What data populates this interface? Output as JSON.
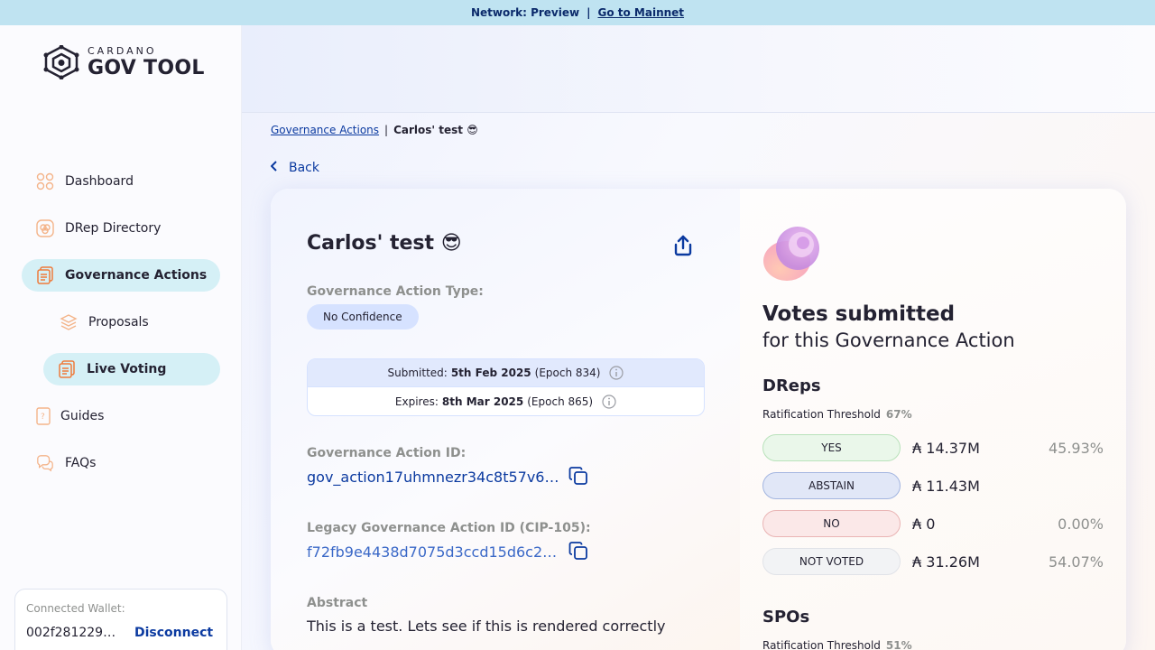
{
  "topbar": {
    "network_label": "Network: Preview",
    "separator": "|",
    "link": "Go to Mainnet"
  },
  "logo": {
    "small": "CARDANO",
    "big": "GOV TOOL"
  },
  "nav": {
    "dashboard": "Dashboard",
    "drep_directory": "DRep Directory",
    "governance_actions": "Governance Actions",
    "proposals": "Proposals",
    "live_voting": "Live Voting",
    "guides": "Guides",
    "faqs": "FAQs"
  },
  "wallet": {
    "label": "Connected Wallet:",
    "address": "002f28122906...",
    "disconnect": "Disconnect"
  },
  "breadcrumb": {
    "parent": "Governance Actions",
    "separator": "|",
    "current": "Carlos' test 😎"
  },
  "back_label": "Back",
  "action": {
    "title": "Carlos' test 😎",
    "type_label": "Governance Action Type:",
    "type_value": "No Confidence",
    "submitted_label": "Submitted:",
    "submitted_date": "5th Feb 2025",
    "submitted_epoch": "(Epoch 834)",
    "expires_label": "Expires:",
    "expires_date": "8th Mar 2025",
    "expires_epoch": "(Epoch 865)",
    "id_label": "Governance Action ID:",
    "id_value": "gov_action17uhmnezr34c8t57v69...",
    "legacy_label": "Legacy Governance Action ID (CIP-105):",
    "legacy_value": "f72fb9e4438d7075d3ccd15d6c2ef...",
    "abstract_label": "Abstract",
    "abstract_text": "This is a test. Lets see if this is rendered correctly"
  },
  "votes": {
    "title": "Votes submitted",
    "subtitle": "for this Governance Action",
    "dreps_title": "DReps",
    "ratification_label": "Ratification Threshold",
    "dreps_threshold": "67%",
    "rows": [
      {
        "label": "YES",
        "amount": "₳ 14.37M",
        "percent": "45.93%",
        "bg": "#eaf7ea",
        "border": "#b9e2bb"
      },
      {
        "label": "ABSTAIN",
        "amount": "₳ 11.43M",
        "percent": "",
        "bg": "#e1e7f7",
        "border": "#a3b5e0"
      },
      {
        "label": "NO",
        "amount": "₳ 0",
        "percent": "0.00%",
        "bg": "#fbe8e8",
        "border": "#eab4b4"
      },
      {
        "label": "NOT VOTED",
        "amount": "₳ 31.26M",
        "percent": "54.07%",
        "bg": "#f2f3f5",
        "border": "#e1e3e8"
      }
    ],
    "spos_title": "SPOs",
    "spos_threshold": "51%"
  },
  "colors": {
    "accent": "#0b3aa0",
    "nav_active": "#d5f0f6",
    "topbar": "#bfe3f1",
    "icon_orange": "#ee7b3c"
  }
}
